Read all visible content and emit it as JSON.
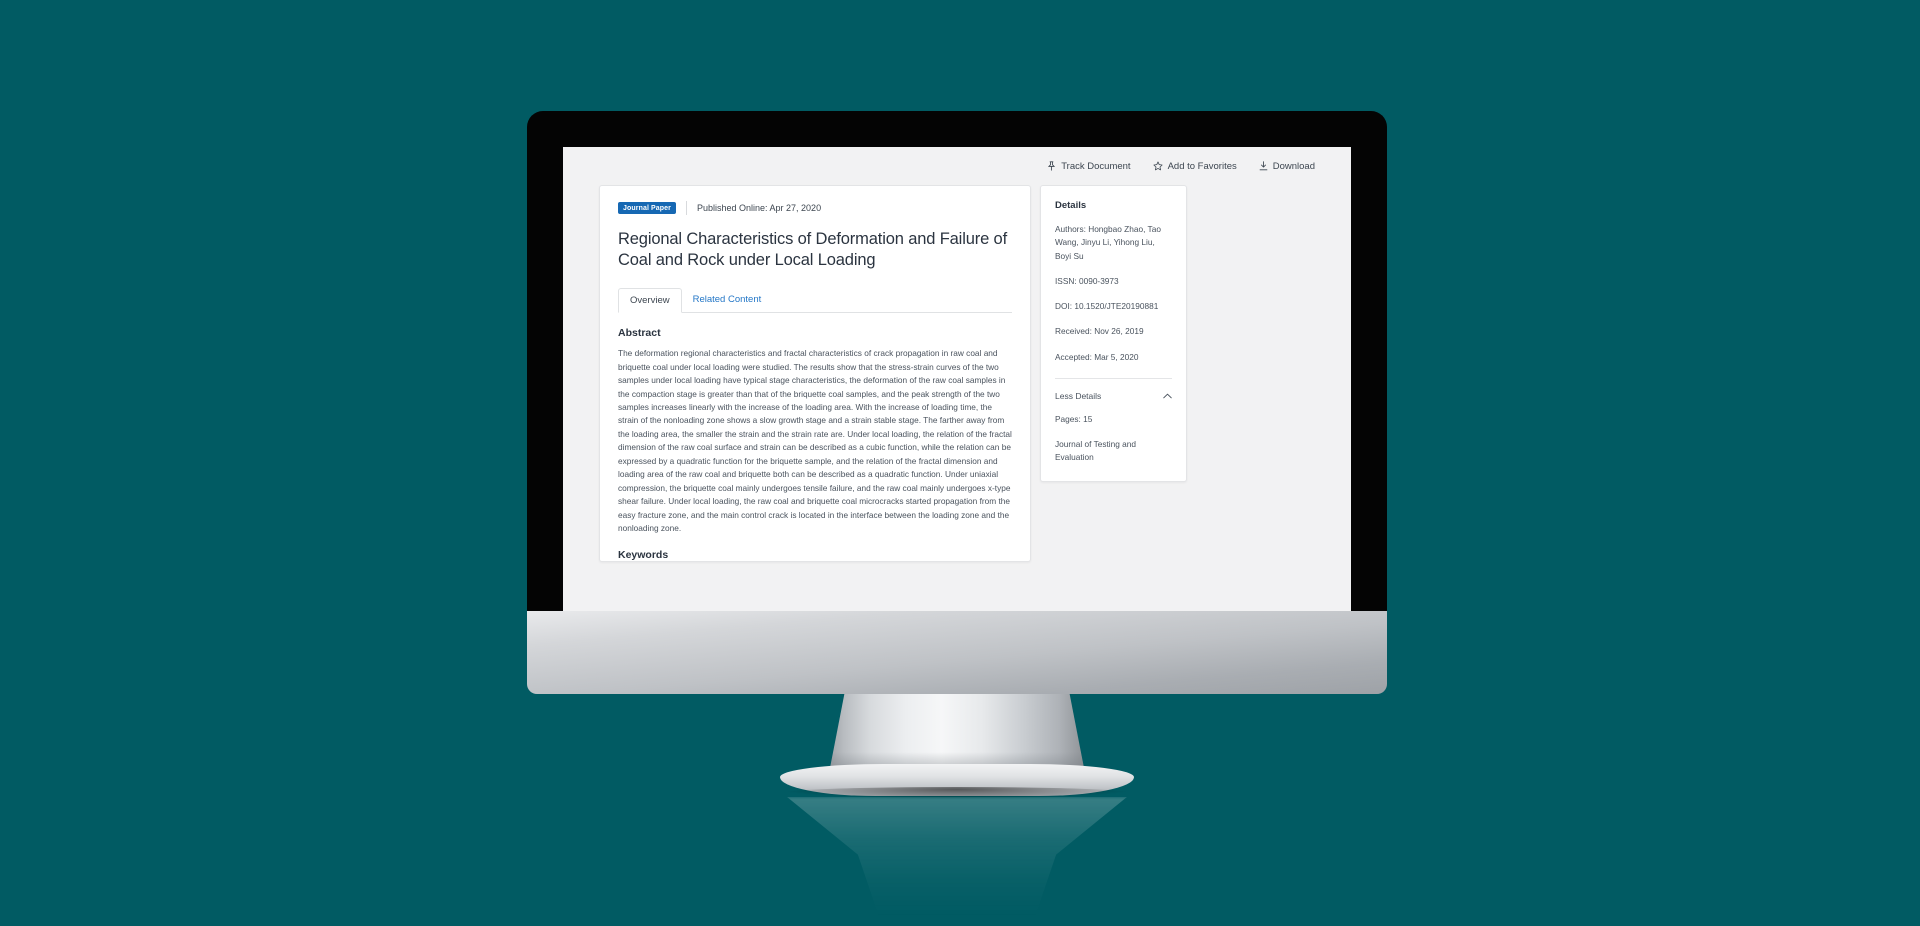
{
  "background_color": "#015b63",
  "device": {
    "type": "desktop-monitor",
    "bezel_color": "#040404",
    "body_color": "#c6c9cd"
  },
  "toolbar": {
    "items": [
      {
        "label": "Track Document",
        "icon": "pin-icon"
      },
      {
        "label": "Add to Favorites",
        "icon": "star-icon"
      },
      {
        "label": "Download",
        "icon": "download-icon"
      }
    ]
  },
  "document": {
    "badge": "Journal Paper",
    "badge_color": "#1668b3",
    "published_online": "Published Online: Apr 27, 2020",
    "title": "Regional Characteristics of Deformation and Failure of Coal and Rock under Local Loading",
    "tabs": [
      {
        "label": "Overview",
        "active": true
      },
      {
        "label": "Related Content",
        "active": false
      }
    ],
    "abstract_heading": "Abstract",
    "abstract": "The deformation regional characteristics and fractal characteristics of crack propagation in raw coal and briquette coal under local loading were studied. The results show that the stress-strain curves of the two samples under local loading have typical stage characteristics, the deformation of the raw coal samples in the compaction stage is greater than that of the briquette coal samples, and the peak strength of the two samples increases linearly with the increase of the loading area. With the increase of loading time, the strain of the nonloading zone shows a slow growth stage and a strain stable stage. The farther away from the loading area, the smaller the strain and the strain rate are. Under local loading, the relation of the fractal dimension of the raw coal surface and strain can be described as a cubic function, while the relation can be expressed by a quadratic function for the briquette sample, and the relation of the fractal dimension and loading area of the raw coal and briquette both can be described as a quadratic function. Under uniaxial compression, the briquette coal mainly undergoes tensile failure, and the raw coal mainly undergoes x-type shear failure. Under local loading, the raw coal and briquette coal microcracks started propagation from the easy fracture zone, and the main control crack is located in the interface between the loading zone and the nonloading zone.",
    "keywords_heading": "Keywords"
  },
  "details": {
    "title": "Details",
    "rows": [
      "Authors: Hongbao Zhao, Tao Wang, Jinyu Li, Yihong Liu, Boyi Su",
      "ISSN: 0090-3973",
      "DOI: 10.1520/JTE20190881",
      "Received: Nov 26, 2019",
      "Accepted: Mar 5, 2020"
    ],
    "toggle_label": "Less Details",
    "toggle_icon": "chevron-up-icon",
    "extra_rows": [
      "Pages: 15",
      "Journal of Testing and Evaluation"
    ]
  }
}
